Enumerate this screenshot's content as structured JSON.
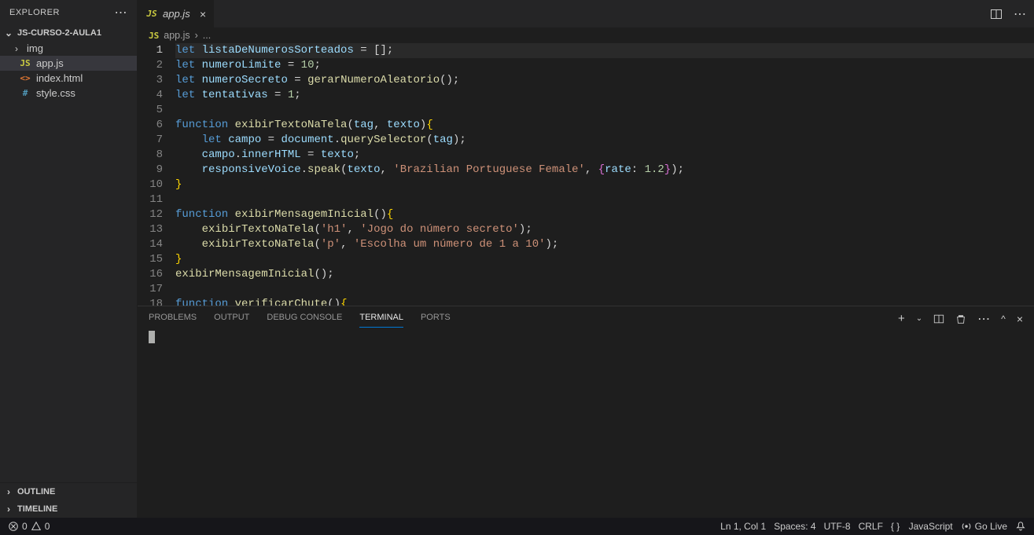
{
  "explorer": {
    "title": "EXPLORER",
    "project": "JS-CURSO-2-AULA1",
    "items": [
      {
        "label": "img",
        "icon": "folder",
        "kind": "folder"
      },
      {
        "label": "app.js",
        "icon": "JS",
        "kind": "js",
        "selected": true
      },
      {
        "label": "index.html",
        "icon": "<>",
        "kind": "html"
      },
      {
        "label": "style.css",
        "icon": "#",
        "kind": "css"
      }
    ],
    "outline": "OUTLINE",
    "timeline": "TIMELINE"
  },
  "tabs": {
    "open": {
      "icon": "JS",
      "label": "app.js"
    }
  },
  "breadcrumb": {
    "icon": "JS",
    "file": "app.js",
    "sep": "›",
    "rest": "..."
  },
  "code": {
    "lines": [
      [
        [
          "key",
          "let"
        ],
        [
          "pun",
          " "
        ],
        [
          "var",
          "listaDeNumerosSorteados"
        ],
        [
          "pun",
          " = []"
        ],
        [
          "pun",
          ";"
        ]
      ],
      [
        [
          "key",
          "let"
        ],
        [
          "pun",
          " "
        ],
        [
          "var",
          "numeroLimite"
        ],
        [
          "pun",
          " = "
        ],
        [
          "num",
          "10"
        ],
        [
          "pun",
          ";"
        ]
      ],
      [
        [
          "key",
          "let"
        ],
        [
          "pun",
          " "
        ],
        [
          "var",
          "numeroSecreto"
        ],
        [
          "pun",
          " = "
        ],
        [
          "fn",
          "gerarNumeroAleatorio"
        ],
        [
          "pun",
          "()"
        ],
        [
          "pun",
          ";"
        ]
      ],
      [
        [
          "key",
          "let"
        ],
        [
          "pun",
          " "
        ],
        [
          "var",
          "tentativas"
        ],
        [
          "pun",
          " = "
        ],
        [
          "num",
          "1"
        ],
        [
          "pun",
          ";"
        ]
      ],
      [],
      [
        [
          "key",
          "function"
        ],
        [
          "pun",
          " "
        ],
        [
          "fn",
          "exibirTextoNaTela"
        ],
        [
          "pun",
          "("
        ],
        [
          "var",
          "tag"
        ],
        [
          "pun",
          ", "
        ],
        [
          "var",
          "texto"
        ],
        [
          "pun",
          ")"
        ],
        [
          "brc",
          "{"
        ]
      ],
      [
        [
          "pun",
          "    "
        ],
        [
          "key",
          "let"
        ],
        [
          "pun",
          " "
        ],
        [
          "var",
          "campo"
        ],
        [
          "pun",
          " = "
        ],
        [
          "var",
          "document"
        ],
        [
          "pun",
          "."
        ],
        [
          "fn",
          "querySelector"
        ],
        [
          "pun",
          "("
        ],
        [
          "var",
          "tag"
        ],
        [
          "pun",
          ")"
        ],
        [
          "pun",
          ";"
        ]
      ],
      [
        [
          "pun",
          "    "
        ],
        [
          "var",
          "campo"
        ],
        [
          "pun",
          "."
        ],
        [
          "prop",
          "innerHTML"
        ],
        [
          "pun",
          " = "
        ],
        [
          "var",
          "texto"
        ],
        [
          "pun",
          ";"
        ]
      ],
      [
        [
          "pun",
          "    "
        ],
        [
          "var",
          "responsiveVoice"
        ],
        [
          "pun",
          "."
        ],
        [
          "fn",
          "speak"
        ],
        [
          "pun",
          "("
        ],
        [
          "var",
          "texto"
        ],
        [
          "pun",
          ", "
        ],
        [
          "str",
          "'Brazilian Portuguese Female'"
        ],
        [
          "pun",
          ", "
        ],
        [
          "brc2",
          "{"
        ],
        [
          "prop",
          "rate"
        ],
        [
          "pun",
          ": "
        ],
        [
          "num",
          "1.2"
        ],
        [
          "brc2",
          "}"
        ],
        [
          "pun",
          ")"
        ],
        [
          "pun",
          ";"
        ]
      ],
      [
        [
          "brc",
          "}"
        ]
      ],
      [],
      [
        [
          "key",
          "function"
        ],
        [
          "pun",
          " "
        ],
        [
          "fn",
          "exibirMensagemInicial"
        ],
        [
          "pun",
          "()"
        ],
        [
          "brc",
          "{"
        ]
      ],
      [
        [
          "pun",
          "    "
        ],
        [
          "fn",
          "exibirTextoNaTela"
        ],
        [
          "pun",
          "("
        ],
        [
          "str",
          "'h1'"
        ],
        [
          "pun",
          ", "
        ],
        [
          "str",
          "'Jogo do número secreto'"
        ],
        [
          "pun",
          ")"
        ],
        [
          "pun",
          ";"
        ]
      ],
      [
        [
          "pun",
          "    "
        ],
        [
          "fn",
          "exibirTextoNaTela"
        ],
        [
          "pun",
          "("
        ],
        [
          "str",
          "'p'"
        ],
        [
          "pun",
          ", "
        ],
        [
          "str",
          "'Escolha um número de 1 a 10'"
        ],
        [
          "pun",
          ")"
        ],
        [
          "pun",
          ";"
        ]
      ],
      [
        [
          "brc",
          "}"
        ]
      ],
      [
        [
          "fn",
          "exibirMensagemInicial"
        ],
        [
          "pun",
          "()"
        ],
        [
          "pun",
          ";"
        ]
      ],
      [],
      [
        [
          "key",
          "function"
        ],
        [
          "pun",
          " "
        ],
        [
          "fn",
          "verificarChute"
        ],
        [
          "pun",
          "()"
        ],
        [
          "brc",
          "{"
        ]
      ]
    ]
  },
  "panel": {
    "tabs": [
      "PROBLEMS",
      "OUTPUT",
      "DEBUG CONSOLE",
      "TERMINAL",
      "PORTS"
    ],
    "active": 3
  },
  "status": {
    "errors": "0",
    "warnings": "0",
    "lncol": "Ln 1, Col 1",
    "spaces": "Spaces: 4",
    "encoding": "UTF-8",
    "eol": "CRLF",
    "lang_braces": "{ }",
    "lang": "JavaScript",
    "golive": "Go Live"
  }
}
